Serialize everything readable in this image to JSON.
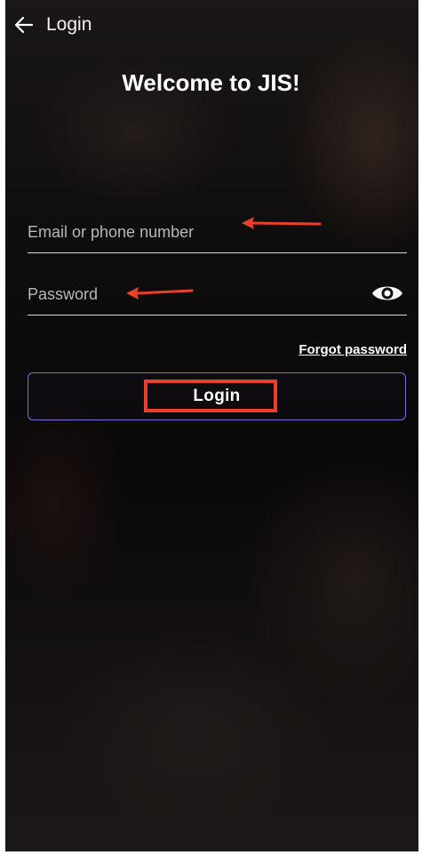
{
  "header": {
    "title": "Login",
    "back_icon": "arrow-left-icon"
  },
  "welcome": {
    "title": "Welcome to JIS!"
  },
  "form": {
    "email_placeholder": "Email or phone number",
    "email_value": "",
    "password_placeholder": "Password",
    "password_value": "",
    "password_toggle_icon": "eye-icon",
    "forgot_password_label": "Forgot password",
    "login_label": "Login"
  },
  "annotations": {
    "color": "#e8402a",
    "items": [
      "arrow-to-email-field",
      "arrow-to-password-field",
      "box-around-login-button"
    ]
  },
  "colors": {
    "button_border": "#7b6ee0",
    "text": "#ffffff",
    "placeholder": "#b7b7b7",
    "underline": "#d9d9d9"
  }
}
